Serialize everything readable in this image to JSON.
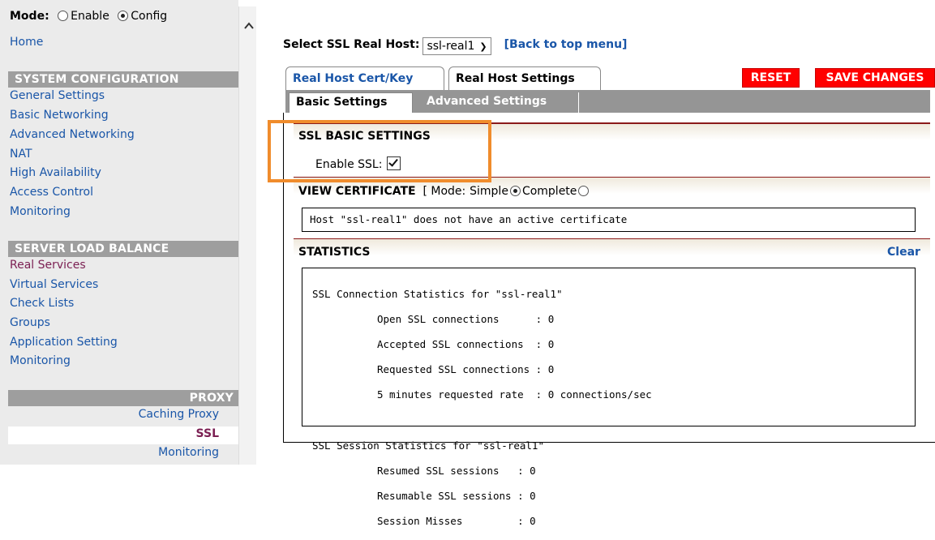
{
  "sidebar": {
    "mode_label": "Mode:",
    "mode_options": [
      {
        "label": "Enable",
        "selected": false
      },
      {
        "label": "Config",
        "selected": true
      }
    ],
    "home": "Home",
    "system_configuration": {
      "header": "SYSTEM CONFIGURATION",
      "items": [
        "General Settings",
        "Basic Networking",
        "Advanced Networking",
        "NAT",
        "High Availability",
        "Access Control",
        "Monitoring"
      ]
    },
    "server_load_balance": {
      "header": "SERVER LOAD BALANCE",
      "items": [
        "Real Services",
        "Virtual Services",
        "Check Lists",
        "Groups",
        "Application Setting",
        "Monitoring"
      ]
    },
    "proxy": {
      "header": "PROXY",
      "items": [
        "Caching Proxy",
        "SSL",
        "Monitoring"
      ],
      "active": "SSL"
    },
    "scroll_up_icon": "chevron-up-icon"
  },
  "main": {
    "select_label": "Select SSL Real Host:",
    "select_value": "ssl-real1",
    "back_link": "[Back to top menu]",
    "tabs": [
      {
        "label": "Real Host Cert/Key",
        "active": false
      },
      {
        "label": "Real Host Settings",
        "active": true
      }
    ],
    "reset_label": "RESET",
    "save_label": "SAVE CHANGES",
    "subtabs": [
      {
        "label": "Basic Settings",
        "active": true
      },
      {
        "label": "Advanced Settings",
        "active": false
      }
    ],
    "ssl_basic": {
      "heading": "SSL BASIC SETTINGS",
      "enable_label": "Enable SSL:",
      "enable_checked": true
    },
    "view_certificate": {
      "heading": "VIEW CERTIFICATE",
      "mode_prefix": "[ Mode:",
      "mode_simple": "Simple",
      "mode_complete": "Complete",
      "simple_selected": true,
      "message": "Host \"ssl-real1\" does not have an active certificate"
    },
    "statistics": {
      "heading": "STATISTICS",
      "clear": "Clear",
      "connection_title": "SSL Connection Statistics for \"ssl-real1\"",
      "connection_lines": [
        "Open SSL connections      : 0",
        "Accepted SSL connections  : 0",
        "Requested SSL connections : 0",
        "5 minutes requested rate  : 0 connections/sec"
      ],
      "session_title": "SSL Session Statistics for \"ssl-real1\"",
      "session_lines": [
        "Resumed SSL sessions   : 0",
        "Resumable SSL sessions : 0",
        "Session Misses         : 0"
      ]
    }
  },
  "colors": {
    "link": "#1a56a8",
    "section_header_bg": "#9e9e9e",
    "reset_bg": "#ff0000",
    "highlight": "#f08c2c",
    "active_nav": "#7b1f52"
  }
}
